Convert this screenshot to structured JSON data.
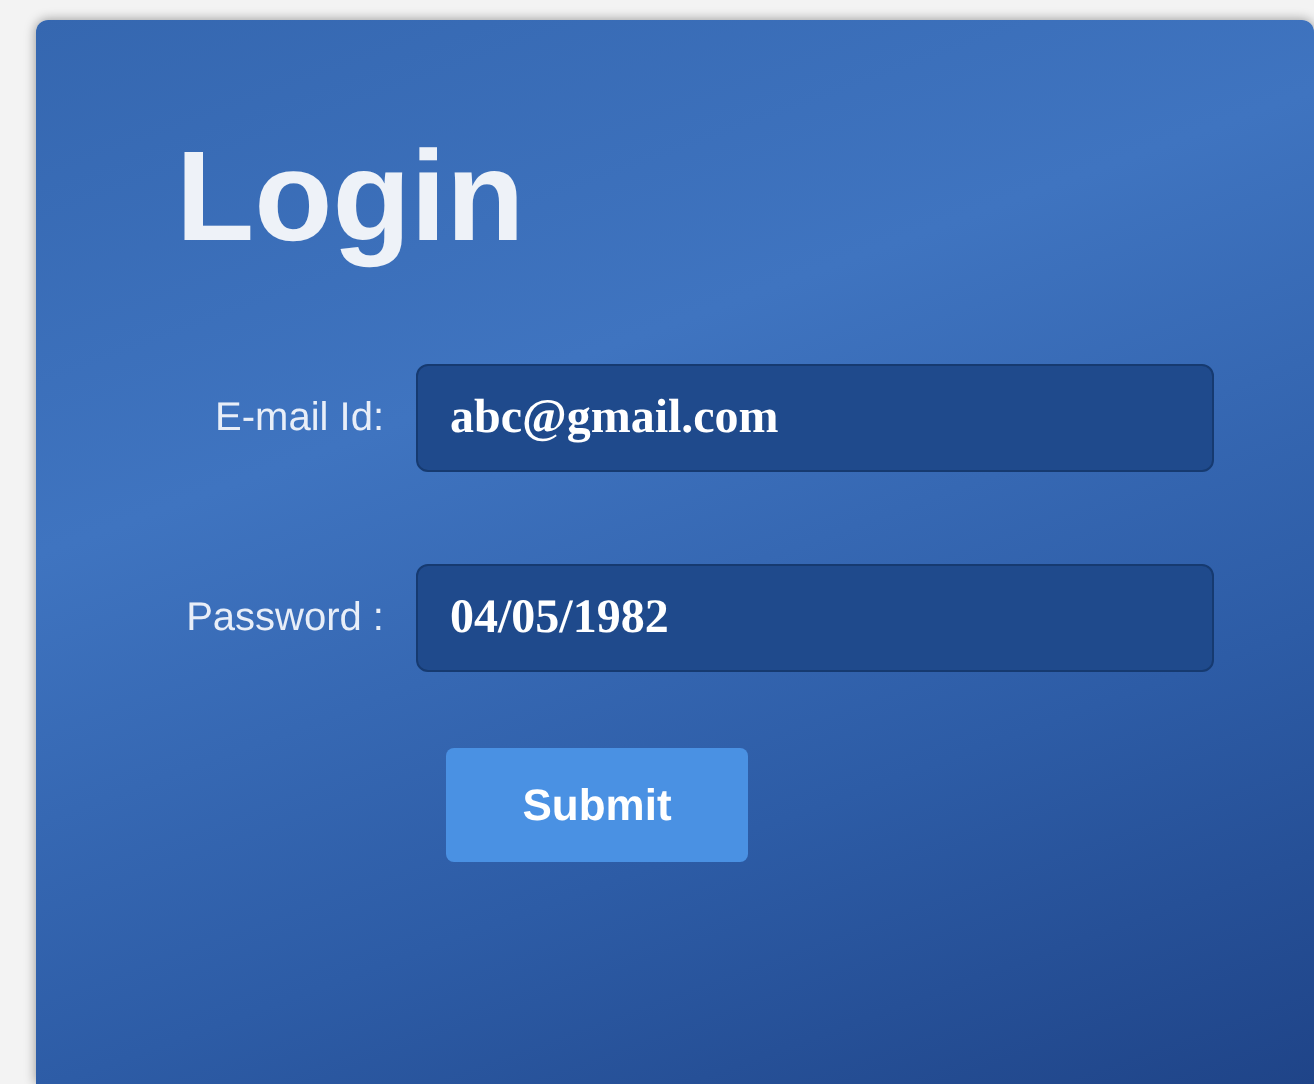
{
  "title": "Login",
  "fields": [
    {
      "label": "E-mail Id:",
      "value": "abc@gmail.com"
    },
    {
      "label": "Password :",
      "value": "04/05/1982"
    }
  ],
  "submit": {
    "label": "Submit"
  }
}
